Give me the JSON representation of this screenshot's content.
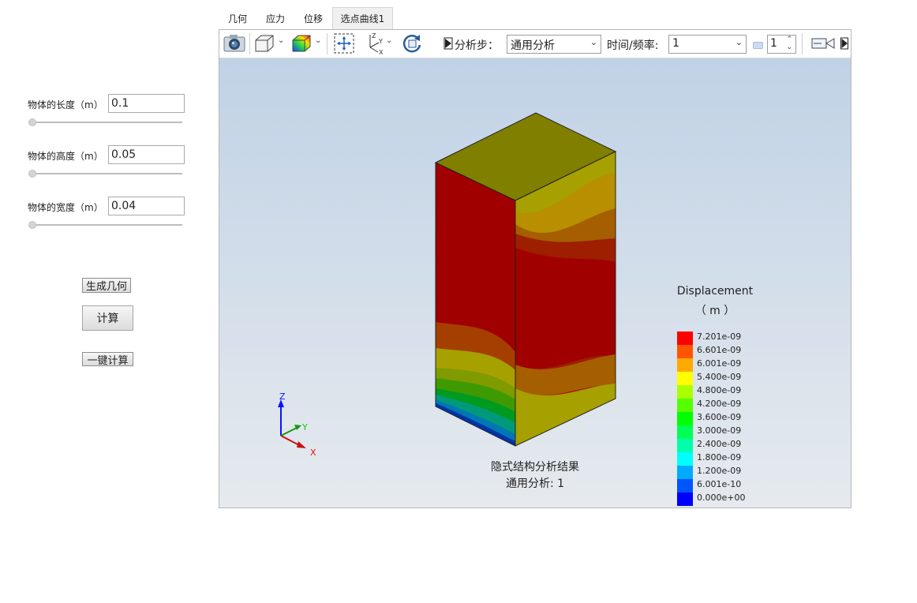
{
  "tabs": [
    "几何",
    "应力",
    "位移",
    "选点曲线1"
  ],
  "params": [
    {
      "label": "物体的长度（m）",
      "value": "0.1"
    },
    {
      "label": "物体的高度（m）",
      "value": "0.05"
    },
    {
      "label": "物体的宽度（m）",
      "value": "0.04"
    }
  ],
  "buttons": {
    "generate": "生成几何",
    "compute": "计算",
    "one_click": "一键计算"
  },
  "toolbar": {
    "step_label": "分析步：",
    "step_value": "通用分析",
    "time_label": "时间/频率:",
    "time_value": "1",
    "spin_value": "1",
    "icons": [
      "camera-icon",
      "cube-view-icon",
      "contour-color-icon",
      "fit-view-icon",
      "axes-icon",
      "rotate-icon",
      "step-nav-icon",
      "record-video-icon"
    ]
  },
  "viewport": {
    "caption_line1": "隐式结构分析结果",
    "caption_line2": "通用分析: 1",
    "axes": {
      "z": "Z",
      "y": "Y",
      "x": "X"
    }
  },
  "legend": {
    "title": "Displacement",
    "unit": "（ m ）",
    "levels": [
      {
        "label": "7.201e-09",
        "color": "#ff0000"
      },
      {
        "label": "6.601e-09",
        "color": "#ff5500"
      },
      {
        "label": "6.001e-09",
        "color": "#ffaa00"
      },
      {
        "label": "5.400e-09",
        "color": "#ffff00"
      },
      {
        "label": "4.800e-09",
        "color": "#aaff00"
      },
      {
        "label": "4.200e-09",
        "color": "#55ff00"
      },
      {
        "label": "3.600e-09",
        "color": "#00ff00"
      },
      {
        "label": "3.000e-09",
        "color": "#00ff55"
      },
      {
        "label": "2.400e-09",
        "color": "#00ffaa"
      },
      {
        "label": "1.800e-09",
        "color": "#00ffff"
      },
      {
        "label": "1.200e-09",
        "color": "#00aaff"
      },
      {
        "label": "6.001e-10",
        "color": "#0055ff"
      },
      {
        "label": "0.000e+00",
        "color": "#0000ff"
      }
    ]
  }
}
